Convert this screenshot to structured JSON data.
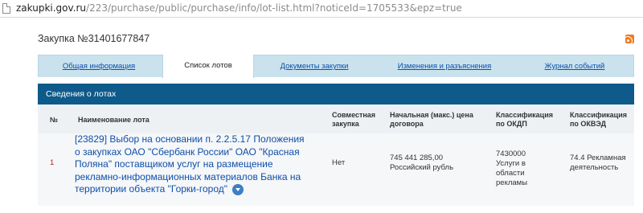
{
  "browser": {
    "url_domain": "zakupki.gov.ru",
    "url_path": "/223/purchase/public/purchase/info/lot-list.html?noticeId=1705533&epz=true"
  },
  "page": {
    "title": "Закупка №31401677847",
    "rss_icon": "rss-icon"
  },
  "tabs": [
    {
      "label": "Общая информация",
      "active": false
    },
    {
      "label": "Список лотов",
      "active": true
    },
    {
      "label": "Документы закупки",
      "active": false
    },
    {
      "label": "Изменения и разъяснения",
      "active": false
    },
    {
      "label": "Журнал событий",
      "active": false
    }
  ],
  "section": {
    "title": "Сведения о лотах"
  },
  "table": {
    "headers": {
      "num": "№",
      "name": "Наименование лота",
      "joint": "Совместная закупка",
      "price": "Начальная (макс.) цена договора",
      "okdp": "Классификация по ОКДП",
      "okved": "Классификация по ОКВЭД"
    },
    "rows": [
      {
        "num": "1",
        "name": "[23829] Выбор на основании п. 2.2.5.17 Положения о закупках ОАО \"Сбербанк России\" ОАО \"Красная Поляна\" поставщиком услуг на размещение рекламно-информационных материалов Банка на территории объекта \"Горки-город\"",
        "joint": "Нет",
        "price": "745 441 285,00 Российский рубль",
        "okdp": "7430000 Услуги в области рекламы",
        "okved": "74.4 Рекламная деятельность"
      }
    ]
  },
  "colors": {
    "section_header_bg": "#0e5a8a",
    "tab_bar_bg": "#c9e2ee",
    "link": "#0f4fa8",
    "row_number": "#b3202b",
    "rss": "#f37a1f"
  }
}
